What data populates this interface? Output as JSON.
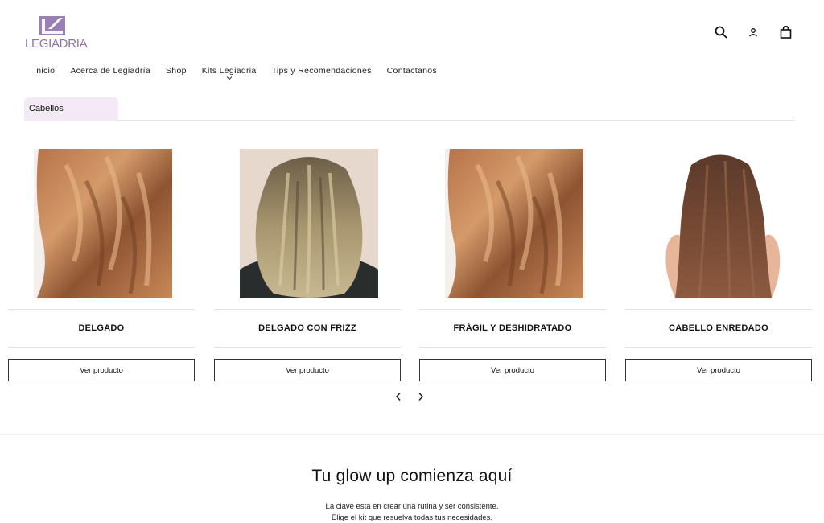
{
  "brand": {
    "logo_text": "LEGIADRIA",
    "accent_color": "#8c74a6"
  },
  "header_icons": [
    "search-icon",
    "account-icon",
    "cart-icon"
  ],
  "nav": {
    "items": [
      {
        "label": "Inicio"
      },
      {
        "label": "Acerca de Legiadría"
      },
      {
        "label": "Shop"
      },
      {
        "label": "Kits Legiadria"
      },
      {
        "label": "Tips y Recomendaciones"
      },
      {
        "label": "Contactanos"
      }
    ]
  },
  "tabs": {
    "active": "Cabellos",
    "active_bg": "#f3eaf6"
  },
  "products": [
    {
      "title": "DELGADO",
      "button": "Ver producto"
    },
    {
      "title": "DELGADO CON FRIZZ",
      "button": "Ver producto"
    },
    {
      "title": "FRÁGIL Y DESHIDRATADO",
      "button": "Ver producto"
    },
    {
      "title": "CABELLO ENREDADO",
      "button": "Ver producto"
    }
  ],
  "hero": {
    "title": "Tu glow up comienza aquí",
    "line1": "La clave está en crear una rutina y ser consistente.",
    "line2": "Elige el kit que resuelva todas tus necesidades."
  }
}
